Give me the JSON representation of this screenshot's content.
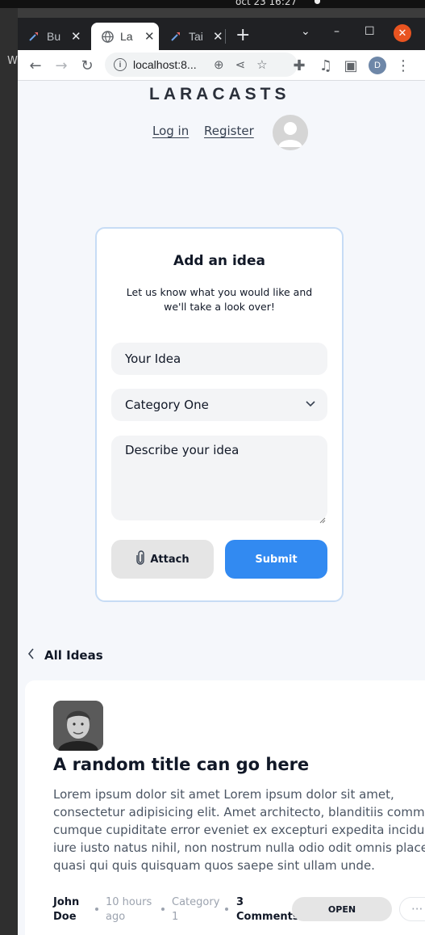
{
  "system": {
    "clock": "oct 23  16:27",
    "side_letter": "W"
  },
  "browser": {
    "tabs": [
      {
        "label": "Bu",
        "close": "✕"
      },
      {
        "label": "La",
        "close": "✕"
      },
      {
        "label": "Tai",
        "close": "✕"
      }
    ],
    "new_tab": "+",
    "url": "localhost:8...",
    "profile_initial": "D"
  },
  "site": {
    "logo": "LARACASTS",
    "login": "Log in",
    "register": "Register"
  },
  "form": {
    "title": "Add an idea",
    "description_line1": "Let us know what you would like and",
    "description_line2": "we'll take a look over!",
    "title_placeholder": "Your Idea",
    "category_selected": "Category One",
    "description_placeholder": "Describe your idea",
    "attach_label": "Attach",
    "submit_label": "Submit"
  },
  "nav": {
    "back_label": "All Ideas"
  },
  "idea": {
    "title": "A random title can go here",
    "body_lines": [
      "Lorem ipsum dolor sit amet Lorem ipsum dolor sit amet,",
      "consectetur adipisicing elit. Amet architecto, blanditiis commodi",
      "cumque cupiditate error eveniet ex excepturi expedita incidunt",
      "iure iusto natus nihil, non nostrum nulla odio odit omnis placeat",
      "quasi qui quis quisquam quos saepe sint ullam unde."
    ],
    "author_first": "John",
    "author_last": "Doe",
    "time_line1": "10 hours",
    "time_line2": "ago",
    "category_line1": "Category",
    "category_line2": "1",
    "comments_line1": "3",
    "comments_line2": "Comments",
    "status": "OPEN",
    "more": "···"
  },
  "colors": {
    "accent": "#328af1",
    "page_bg": "#f5f7fb",
    "window_close": "#e95420"
  }
}
